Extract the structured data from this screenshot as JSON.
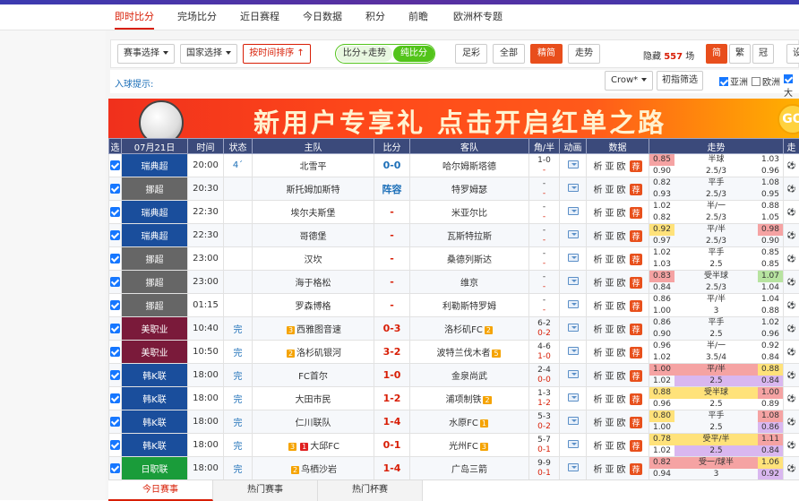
{
  "nav": {
    "tabs": [
      {
        "label": "即时比分",
        "active": true
      },
      {
        "label": "完场比分"
      },
      {
        "label": "近日赛程"
      },
      {
        "label": "今日数据"
      },
      {
        "label": "积分"
      },
      {
        "label": "前瞻"
      },
      {
        "label": "欧洲杯专题"
      }
    ]
  },
  "toolbar": {
    "league_select": "赛事选择",
    "country_select": "国家选择",
    "sort_by_time": "按时间排序 ↑",
    "toggle_on": "比分+走势",
    "toggle_off": "纯比分",
    "football_lottery": "足彩",
    "all": "全部",
    "simplified": "精简",
    "trend": "走势",
    "hidden_prefix": "隐藏",
    "hidden_count": "557",
    "hidden_suffix": "场",
    "lang_simplified": "简",
    "lang_traditional": "繁",
    "lang_crown": "冠",
    "settings": "设"
  },
  "subbar": {
    "goal_hint": "入球提示:",
    "company_select": "Crow*",
    "initial_filter": "初指筛选",
    "asia_label": "亚洲",
    "asia_checked": true,
    "europe_label": "欧洲",
    "europe_checked": false,
    "big_label": "大",
    "big_checked": true
  },
  "banner": {
    "text": "新用户专享礼  点击开启红单之路",
    "coin_text": "GO"
  },
  "table": {
    "headers": [
      "选",
      "07月21日",
      "时间",
      "状态",
      "主队",
      "比分",
      "客队",
      "角/半",
      "动画",
      "数据",
      "走势",
      "走"
    ],
    "rows": [
      {
        "league": "瑞典超",
        "lcolor": "#1a4e9c",
        "time": "20:00",
        "status": "4´",
        "home": "北雪平",
        "hrank": [],
        "score": "0-0",
        "scls": "blue",
        "away": "哈尔姆斯塔德",
        "arank": [],
        "c1": "1-0",
        "c2": "-",
        "o": [
          [
            "0.85",
            "半球",
            "1.03"
          ],
          [
            "0.90",
            "2.5/3",
            "0.96"
          ]
        ],
        "hl": [
          [
            "hl",
            "",
            ""
          ],
          [
            "",
            "",
            ""
          ]
        ]
      },
      {
        "league": "挪超",
        "lcolor": "#666666",
        "time": "20:30",
        "status": "",
        "home": "斯托姆加斯特",
        "hrank": [],
        "score": "阵容",
        "scls": "blue",
        "away": "特罗姆瑟",
        "arank": [],
        "c1": "-",
        "c2": "-",
        "o": [
          [
            "0.82",
            "平手",
            "1.08"
          ],
          [
            "0.93",
            "2.5/3",
            "0.95"
          ]
        ],
        "hl": [
          [
            "",
            "",
            ""
          ],
          [
            "",
            "",
            ""
          ]
        ]
      },
      {
        "league": "瑞典超",
        "lcolor": "#1a4e9c",
        "time": "22:30",
        "status": "",
        "home": "埃尔夫斯堡",
        "hrank": [],
        "score": "-",
        "scls": "",
        "away": "米亚尔比",
        "arank": [],
        "c1": "-",
        "c2": "-",
        "o": [
          [
            "1.02",
            "半/一",
            "0.88"
          ],
          [
            "0.82",
            "2.5/3",
            "1.05"
          ]
        ],
        "hl": [
          [
            "",
            "",
            ""
          ],
          [
            "",
            "",
            ""
          ]
        ]
      },
      {
        "league": "瑞典超",
        "lcolor": "#1a4e9c",
        "time": "22:30",
        "status": "",
        "home": "哥德堡",
        "hrank": [],
        "score": "-",
        "scls": "",
        "away": "瓦斯特拉斯",
        "arank": [],
        "c1": "-",
        "c2": "-",
        "o": [
          [
            "0.92",
            "平/半",
            "0.98"
          ],
          [
            "0.97",
            "2.5/3",
            "0.90"
          ]
        ],
        "hl": [
          [
            "hy",
            "",
            "hl"
          ],
          [
            "",
            "",
            ""
          ]
        ]
      },
      {
        "league": "挪超",
        "lcolor": "#666666",
        "time": "23:00",
        "status": "",
        "home": "汉坎",
        "hrank": [],
        "score": "-",
        "scls": "",
        "away": "桑德列斯达",
        "arank": [],
        "c1": "-",
        "c2": "-",
        "o": [
          [
            "1.02",
            "平手",
            "0.85"
          ],
          [
            "1.03",
            "2.5",
            "0.85"
          ]
        ],
        "hl": [
          [
            "",
            "",
            ""
          ],
          [
            "",
            "",
            ""
          ]
        ]
      },
      {
        "league": "挪超",
        "lcolor": "#666666",
        "time": "23:00",
        "status": "",
        "home": "海于格松",
        "hrank": [],
        "score": "-",
        "scls": "",
        "away": "维京",
        "arank": [],
        "c1": "-",
        "c2": "-",
        "o": [
          [
            "0.83",
            "受半球",
            "1.07"
          ],
          [
            "0.84",
            "2.5/3",
            "1.04"
          ]
        ],
        "hl": [
          [
            "hl",
            "",
            "hg"
          ],
          [
            "",
            "",
            ""
          ]
        ]
      },
      {
        "league": "挪超",
        "lcolor": "#666666",
        "time": "01:15",
        "status": "",
        "home": "罗森博格",
        "hrank": [],
        "score": "-",
        "scls": "",
        "away": "利勒斯特罗姆",
        "arank": [],
        "c1": "-",
        "c2": "-",
        "o": [
          [
            "0.86",
            "平/半",
            "1.04"
          ],
          [
            "1.00",
            "3",
            "0.88"
          ]
        ],
        "hl": [
          [
            "",
            "",
            ""
          ],
          [
            "",
            "",
            ""
          ]
        ]
      },
      {
        "league": "美职业",
        "lcolor": "#7a1a3a",
        "time": "10:40",
        "status": "完",
        "home": "西雅图音速",
        "hrank": [
          "3"
        ],
        "score": "0-3",
        "scls": "",
        "away": "洛杉矶FC",
        "arank": [
          "2"
        ],
        "c1": "6-2",
        "c2": "0-2",
        "o": [
          [
            "0.86",
            "平手",
            "1.02"
          ],
          [
            "0.90",
            "2.5",
            "0.96"
          ]
        ],
        "hl": [
          [
            "",
            "",
            ""
          ],
          [
            "",
            "",
            ""
          ]
        ]
      },
      {
        "league": "美职业",
        "lcolor": "#7a1a3a",
        "time": "10:50",
        "status": "完",
        "home": "洛杉矶银河",
        "hrank": [
          "2"
        ],
        "score": "3-2",
        "scls": "",
        "away": "波特兰伐木者",
        "arank": [
          "5"
        ],
        "c1": "4-6",
        "c2": "1-0",
        "o": [
          [
            "0.96",
            "半/一",
            "0.92"
          ],
          [
            "1.02",
            "3.5/4",
            "0.84"
          ]
        ],
        "hl": [
          [
            "",
            "",
            ""
          ],
          [
            "",
            "",
            ""
          ]
        ]
      },
      {
        "league": "韩K联",
        "lcolor": "#1a4e9c",
        "time": "18:00",
        "status": "完",
        "home": "FC首尔",
        "hrank": [],
        "score": "1-0",
        "scls": "",
        "away": "金泉尚武",
        "arank": [],
        "c1": "2-4",
        "c2": "0-0",
        "o": [
          [
            "1.00",
            "平/半",
            "0.88"
          ],
          [
            "1.02",
            "2.5",
            "0.84"
          ]
        ],
        "hl": [
          [
            "hl",
            "hl",
            "hy"
          ],
          [
            "",
            "hv",
            "hv"
          ]
        ]
      },
      {
        "league": "韩K联",
        "lcolor": "#1a4e9c",
        "time": "18:00",
        "status": "完",
        "home": "大田市民",
        "hrank": [],
        "score": "1-2",
        "scls": "",
        "away": "浦项制铁",
        "arank": [
          "2"
        ],
        "c1": "1-3",
        "c2": "1-2",
        "o": [
          [
            "0.88",
            "受半球",
            "1.00"
          ],
          [
            "0.96",
            "2.5",
            "0.89"
          ]
        ],
        "hl": [
          [
            "hy",
            "hy",
            "hl"
          ],
          [
            "",
            "",
            ""
          ]
        ]
      },
      {
        "league": "韩K联",
        "lcolor": "#1a4e9c",
        "time": "18:00",
        "status": "完",
        "home": "仁川联队",
        "hrank": [],
        "score": "1-4",
        "scls": "",
        "away": "水原FC",
        "arank": [
          "1"
        ],
        "c1": "5-3",
        "c2": "0-2",
        "o": [
          [
            "0.80",
            "平手",
            "1.08"
          ],
          [
            "1.00",
            "2.5",
            "0.86"
          ]
        ],
        "hl": [
          [
            "hy",
            "",
            "hl"
          ],
          [
            "",
            "",
            "hv"
          ]
        ]
      },
      {
        "league": "韩K联",
        "lcolor": "#1a4e9c",
        "time": "18:00",
        "status": "完",
        "home": "大邱FC",
        "hrank": [
          "3",
          "1r"
        ],
        "score": "0-1",
        "scls": "",
        "away": "光州FC",
        "arank": [
          "3"
        ],
        "c1": "5-7",
        "c2": "0-1",
        "o": [
          [
            "0.78",
            "受平/半",
            "1.11"
          ],
          [
            "1.02",
            "2.5",
            "0.84"
          ]
        ],
        "hl": [
          [
            "hy",
            "hy",
            "hl"
          ],
          [
            "",
            "hv",
            "hv"
          ]
        ]
      },
      {
        "league": "日职联",
        "lcolor": "#1a9c3a",
        "time": "18:00",
        "status": "完",
        "home": "鸟栖沙岩",
        "hrank": [
          "2"
        ],
        "score": "1-4",
        "scls": "",
        "away": "广岛三箭",
        "arank": [],
        "c1": "9-9",
        "c2": "0-1",
        "o": [
          [
            "0.82",
            "受一/球半",
            "1.06"
          ],
          [
            "0.94",
            "3",
            "0.92"
          ]
        ],
        "hl": [
          [
            "hl",
            "hl",
            "hy"
          ],
          [
            "",
            "",
            "hv"
          ]
        ]
      }
    ],
    "data_links": [
      "析",
      "亚",
      "欧"
    ],
    "data_badge": "荐"
  },
  "bottom_tabs": [
    "今日赛事",
    "热门赛事",
    "热门杯赛"
  ],
  "colors": {
    "accent": "#d81e06",
    "header_bg": "#3b4a7b",
    "green": "#52c41a"
  }
}
